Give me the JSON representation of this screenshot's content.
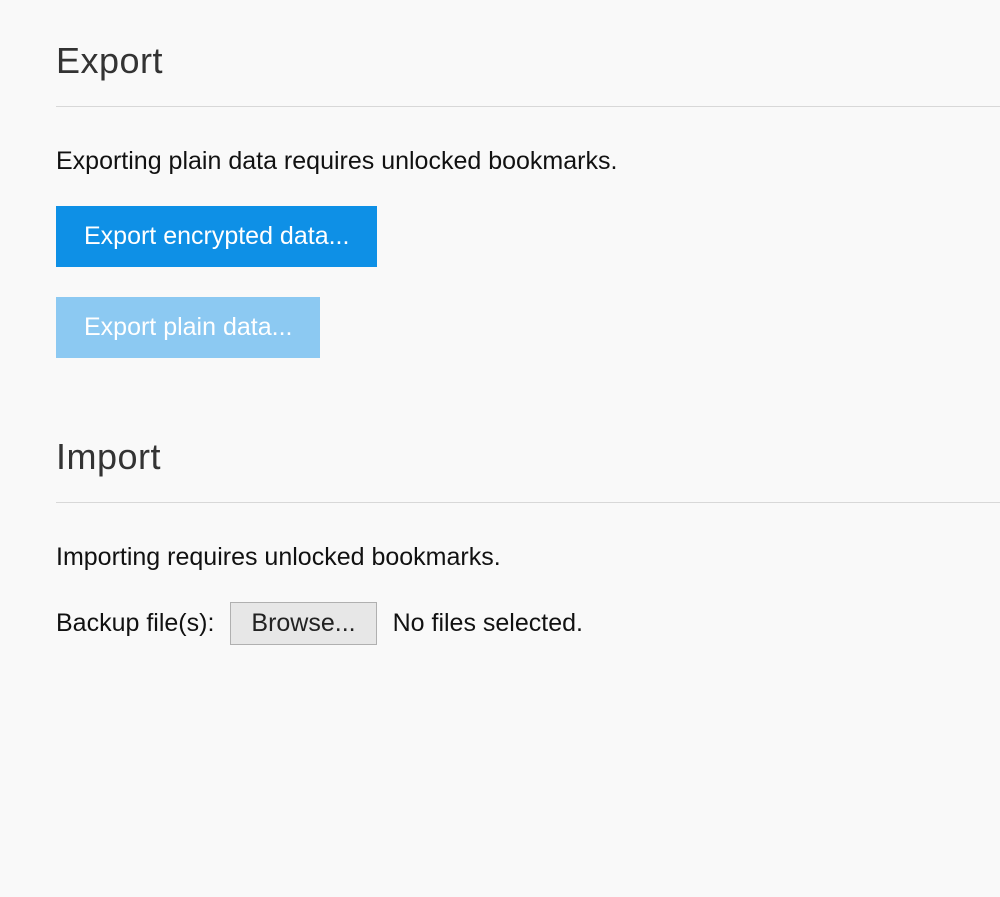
{
  "export": {
    "heading": "Export",
    "description": "Exporting plain data requires unlocked bookmarks.",
    "encrypted_button": "Export encrypted data...",
    "plain_button": "Export plain data..."
  },
  "import": {
    "heading": "Import",
    "description": "Importing requires unlocked bookmarks.",
    "file_label": "Backup file(s):",
    "browse_button": "Browse...",
    "file_status": "No files selected."
  },
  "colors": {
    "primary": "#0e90e6",
    "primary_disabled": "#8cc9f2",
    "divider": "#d8d8d8",
    "background": "#f9f9f9",
    "browse_bg": "#e7e7e7",
    "browse_border": "#b0b0b0"
  }
}
